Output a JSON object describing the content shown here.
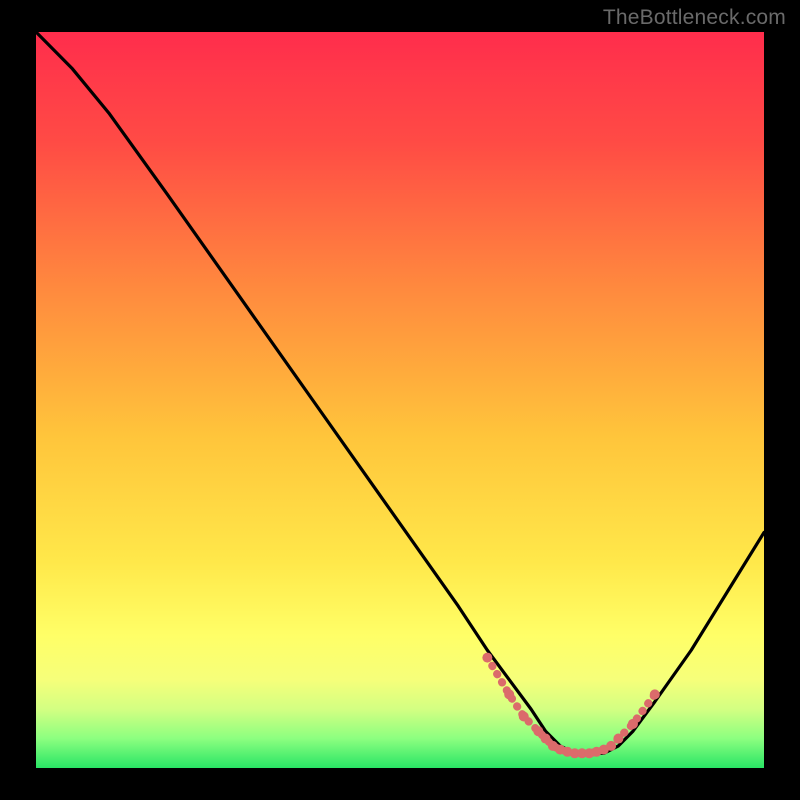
{
  "watermark": "TheBottleneck.com",
  "chart_data": {
    "type": "line",
    "title": "",
    "xlabel": "",
    "ylabel": "",
    "xlim": [
      0,
      100
    ],
    "ylim": [
      0,
      100
    ],
    "series": [
      {
        "name": "curve",
        "color": "#000000",
        "x": [
          0,
          5,
          10,
          18,
          28,
          38,
          48,
          58,
          62,
          65,
          68,
          70,
          72,
          74,
          76,
          78,
          80,
          82,
          85,
          90,
          95,
          100
        ],
        "y": [
          100,
          95,
          89,
          78,
          64,
          50,
          36,
          22,
          16,
          12,
          8,
          5,
          3,
          2,
          2,
          2,
          3,
          5,
          9,
          16,
          24,
          32
        ]
      },
      {
        "name": "bottom-dots",
        "color": "#db6b6b",
        "x": [
          62,
          65,
          67,
          69,
          70,
          71,
          72,
          73,
          74,
          75,
          76,
          77,
          78,
          79,
          80,
          82,
          85
        ],
        "y": [
          15,
          10,
          7,
          5,
          4,
          3,
          2.5,
          2.2,
          2,
          2,
          2,
          2.2,
          2.5,
          3,
          4,
          6,
          10
        ]
      }
    ],
    "gradient_stops": [
      {
        "offset": 0.0,
        "color": "#ff2d4c"
      },
      {
        "offset": 0.15,
        "color": "#ff4b45"
      },
      {
        "offset": 0.35,
        "color": "#ff8a3e"
      },
      {
        "offset": 0.55,
        "color": "#ffc53b"
      },
      {
        "offset": 0.72,
        "color": "#ffe84a"
      },
      {
        "offset": 0.82,
        "color": "#ffff67"
      },
      {
        "offset": 0.88,
        "color": "#f6ff7a"
      },
      {
        "offset": 0.92,
        "color": "#d3ff82"
      },
      {
        "offset": 0.96,
        "color": "#8cff80"
      },
      {
        "offset": 1.0,
        "color": "#29e565"
      }
    ]
  }
}
